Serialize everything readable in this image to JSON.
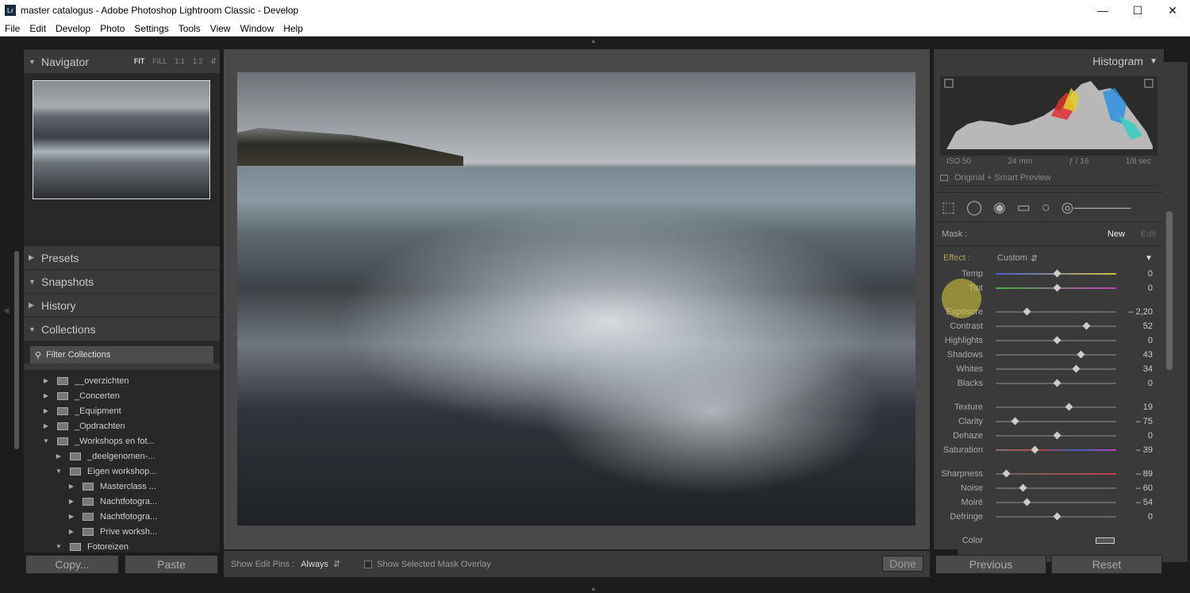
{
  "window": {
    "title": "master catalogus - Adobe Photoshop Lightroom Classic - Develop",
    "logo": "Lr"
  },
  "menu": [
    "File",
    "Edit",
    "Develop",
    "Photo",
    "Settings",
    "Tools",
    "View",
    "Window",
    "Help"
  ],
  "navigator": {
    "title": "Navigator",
    "options": [
      "FIT",
      "FILL",
      "1:1",
      "1:2"
    ]
  },
  "panels": {
    "presets": "Presets",
    "snapshots": "Snapshots",
    "history": "History",
    "collections": "Collections",
    "filter_placeholder": "Filter Collections"
  },
  "collections": [
    {
      "label": "__overzichten",
      "indent": 0,
      "open": false
    },
    {
      "label": "_Concerten",
      "indent": 0,
      "open": false
    },
    {
      "label": "_Equipment",
      "indent": 0,
      "open": false
    },
    {
      "label": "_Opdrachten",
      "indent": 0,
      "open": false
    },
    {
      "label": "_Workshops en fot...",
      "indent": 0,
      "open": true
    },
    {
      "label": "_deelgenomen-...",
      "indent": 1,
      "open": false
    },
    {
      "label": "Eigen workshop...",
      "indent": 1,
      "open": true
    },
    {
      "label": "Masterclass ...",
      "indent": 2,
      "open": false
    },
    {
      "label": "Nachtfotogra...",
      "indent": 2,
      "open": false
    },
    {
      "label": "Nachtfotogra...",
      "indent": 2,
      "open": false
    },
    {
      "label": "Prive worksh...",
      "indent": 2,
      "open": false
    },
    {
      "label": "Fotoreizen",
      "indent": 1,
      "open": true
    }
  ],
  "left_buttons": {
    "copy": "Copy...",
    "paste": "Paste"
  },
  "center_bar": {
    "pins_label": "Show Edit Pins :",
    "pins_value": "Always",
    "overlay_label": "Show Selected Mask Overlay",
    "done": "Done"
  },
  "histogram": {
    "title": "Histogram",
    "iso": "ISO 50",
    "focal": "24 mm",
    "aperture": "ƒ / 16",
    "shutter": "1/8 sec",
    "preview": "Original + Smart Preview"
  },
  "mask": {
    "label": "Mask :",
    "new": "New",
    "edit": "Edit"
  },
  "effect": {
    "label": "Effect :",
    "value": "Custom"
  },
  "sliders": [
    {
      "name": "Temp",
      "value": "0",
      "pos": 0.5,
      "group": 1
    },
    {
      "name": "Tint",
      "value": "0",
      "pos": 0.5,
      "group": 1
    },
    {
      "name": "Exposure",
      "value": "– 2,20",
      "pos": 0.24,
      "group": 2
    },
    {
      "name": "Contrast",
      "value": "52",
      "pos": 0.75,
      "group": 2
    },
    {
      "name": "Highlights",
      "value": "0",
      "pos": 0.5,
      "group": 2
    },
    {
      "name": "Shadows",
      "value": "43",
      "pos": 0.7,
      "group": 2
    },
    {
      "name": "Whites",
      "value": "34",
      "pos": 0.66,
      "group": 2
    },
    {
      "name": "Blacks",
      "value": "0",
      "pos": 0.5,
      "group": 2
    },
    {
      "name": "Texture",
      "value": "19",
      "pos": 0.6,
      "group": 3
    },
    {
      "name": "Clarity",
      "value": "– 75",
      "pos": 0.14,
      "group": 3
    },
    {
      "name": "Dehaze",
      "value": "0",
      "pos": 0.5,
      "group": 3
    },
    {
      "name": "Saturation",
      "value": "– 39",
      "pos": 0.31,
      "group": 3
    },
    {
      "name": "Sharpness",
      "value": "– 89",
      "pos": 0.07,
      "group": 4
    },
    {
      "name": "Noise",
      "value": "– 60",
      "pos": 0.21,
      "group": 4
    },
    {
      "name": "Moiré",
      "value": "– 54",
      "pos": 0.24,
      "group": 4
    },
    {
      "name": "Defringe",
      "value": "0",
      "pos": 0.5,
      "group": 4
    }
  ],
  "color_label": "Color",
  "right_buttons": {
    "previous": "Previous",
    "reset": "Reset"
  }
}
